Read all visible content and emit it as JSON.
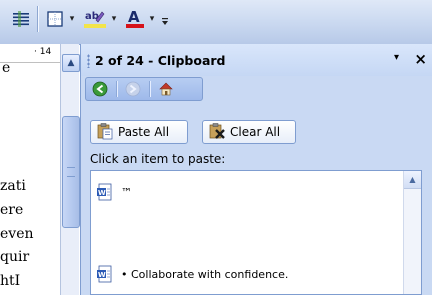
{
  "toolbar": {
    "buttons": [
      {
        "name": "justify-icon"
      },
      {
        "name": "borders-icon"
      },
      {
        "name": "highlight-icon",
        "label": "ab"
      },
      {
        "name": "font-color-icon",
        "label": "A"
      }
    ],
    "accent_highlight": "#f2e44a",
    "accent_font_color": "#d6121a"
  },
  "ruler": {
    "text": "· 14"
  },
  "document": {
    "lines": [
      "e",
      "zati",
      "ere",
      "even",
      "quir",
      "htI"
    ]
  },
  "pane": {
    "title": "2 of 24 - Clipboard",
    "menu_glyph": "▾",
    "close_glyph": "×",
    "paste_all_label": "Paste All",
    "clear_all_label": "Clear All",
    "instruction": "Click an item to paste:",
    "items": [
      {
        "text": "™"
      },
      {
        "text": "• Collaborate with confidence."
      }
    ]
  }
}
